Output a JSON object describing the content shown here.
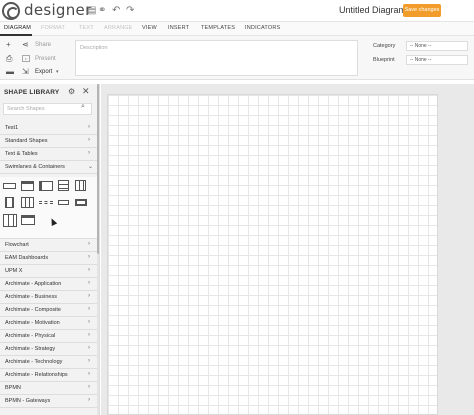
{
  "header": {
    "brand": "designer",
    "doc_title": "Untitled Diagram",
    "save_label": "Save changes"
  },
  "menu": {
    "items": [
      "DIAGRAM",
      "FORMAT",
      "TEXT",
      "ARRANGE",
      "VIEW",
      "INSERT",
      "TEMPLATES",
      "INDICATORS"
    ]
  },
  "toolbar": {
    "share": "Share",
    "present": "Present",
    "export": "Export",
    "description_placeholder": "Description",
    "category_label": "Category",
    "category_value": "-- None --",
    "blueprint_label": "Blueprint",
    "blueprint_value": "-- None --"
  },
  "sidebar": {
    "title": "SHAPE LIBRARY",
    "search_placeholder": "Search Shapes",
    "categories": [
      "Test1",
      "Standard Shapes",
      "Text & Tables",
      "Swimlanes & Containers",
      "Flowchart",
      "EAM Dashboards",
      "UPM X",
      "Archimate - Application",
      "Archimate - Business",
      "Archimate - Composite",
      "Archimate - Motivation",
      "Archimate - Physical",
      "Archimate - Strategy",
      "Archimate - Technology",
      "Archimate - Relationships",
      "BPMN",
      "BPMN - Gateways"
    ]
  },
  "colors": {
    "accent": "#f29c2b",
    "sidebar_bg": "#f2f2f2",
    "canvas_bg": "#e9e9e9"
  }
}
